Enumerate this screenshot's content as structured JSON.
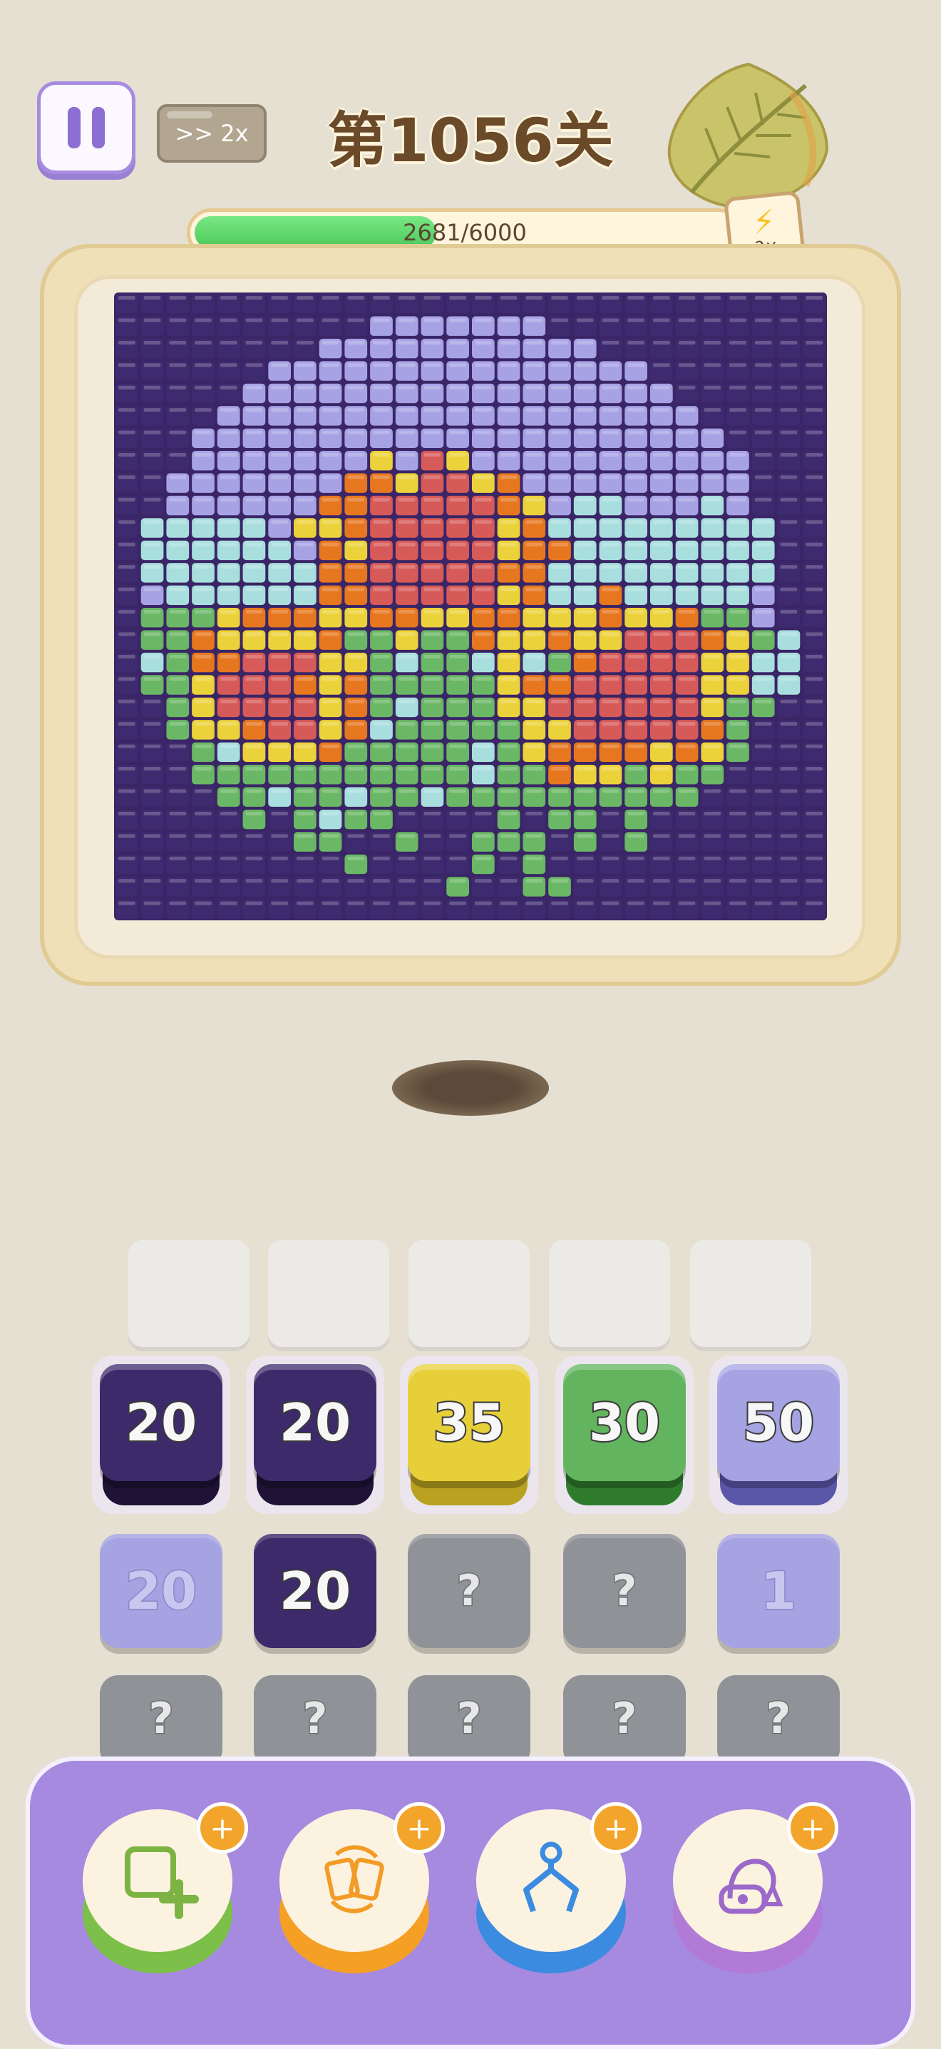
{
  "header": {
    "level_title": "第1056关",
    "speed_label": ">> 2x",
    "pause_icon": "pause-icon"
  },
  "progress": {
    "text": "2681/6000",
    "current": 2681,
    "max": 6000,
    "fill_color": "#4cc85a",
    "boost_label": "2×",
    "boost_icon": "lightning-icon"
  },
  "board": {
    "palette": {
      "P": "#3e2a6e",
      "L": "#a7a2e4",
      "C": "#a9dede",
      "O": "#e6771f",
      "Y": "#ecd23a",
      "R": "#d65a58",
      "G": "#6ab765"
    },
    "rows": [
      "PPPPPPPPPPPPPPPPPPPPPPPPPPPP",
      "PPPPPPPPPPLLLLLLLPPPPPPPPPPP",
      "PPPPPPPPLLLLLLLLLLLPPPPPPPPP",
      "PPPPPPLLLLLLLLLLLLLLLPPPPPPP",
      "PPPPPLLLLLLLLLLLLLLLLLPPPPPP",
      "PPPPLLLLLLLLLLLLLLLLLLLPPPPP",
      "PPPLLLLLLLLLLLLLLLLLLLLLPPPP",
      "PPPLLLLLLLYLRYLLLLLLLLLLLPPP",
      "PPLLLLLLLOOYRRYOLLLLLLLLLPPP",
      "PPLLLLLLOORRRRROYLCCLLLCLPPP",
      "PCCCCCLYYORRRRRYOCCCCCCCCCPP",
      "PCCCCCCLOYRRRRRYOOCCCCCCCCPP",
      "PCCCCCCCOORRRRROOCCCCCCCCCPP",
      "PLCCCCCCOORRRRRYOCCOCCCCCLPP",
      "PGGGYOOOYYOOYYOOYYYOYYOGGLPP",
      "PGGOYYYYOGGYGGOYYOYYRRROYGCP",
      "PCGOORRRYYGCGGCYCGORRRRYYCCP",
      "PGGYRRROYOGGGGGYOORRRRRYYCCP",
      "PPGYRRRRYOGCGGGYYRRRRRRYGGPP",
      "PPGYYORRYOCGGGGGYYRRRRROGPPP",
      "PPPGCYYYOGGGGGCGYOOOOYOYGPPP",
      "PPPGGGGGGGGGGGCGGOYYGYGGPPPP",
      "PPPPGGCGGCGGCGGGGGGGGGGPPPPP",
      "PPPPPGPGCGGPPPPGPGGPGPPPPPPP",
      "PPPPPPPGGPPGPPGGGPGPGPPPPPPP",
      "PPPPPPPPPGPPPPGPGPPPPPPPPPPP",
      "PPPPPPPPPPPPPGPPGGPPPPPPPPPP",
      "PPPPPPPPPPPPPPPPPPPPPPPPPPPP"
    ]
  },
  "queue": {
    "empty_slots": 5
  },
  "tiles_row1": [
    {
      "value": "20",
      "color": "#3d2a6a",
      "under": "#1e1336"
    },
    {
      "value": "20",
      "color": "#3d2a6a",
      "under": "#1e1336"
    },
    {
      "value": "35",
      "color": "#e7cf3a",
      "under": "#b8a21f"
    },
    {
      "value": "30",
      "color": "#62b45e",
      "under": "#2f7b2c"
    },
    {
      "value": "50",
      "color": "#a6a3e2",
      "under": "#5a57a8"
    }
  ],
  "tiles_row2": [
    {
      "value": "20",
      "color": "#a6a3e2"
    },
    {
      "value": "20",
      "color": "#3d2a6a"
    },
    {
      "value": "?",
      "color": "#8f9296"
    },
    {
      "value": "?",
      "color": "#8f9296"
    },
    {
      "value": "1",
      "color": "#a6a3e2"
    }
  ],
  "tiles_row3": [
    {
      "value": "?",
      "color": "#8f9296"
    },
    {
      "value": "?",
      "color": "#8f9296"
    },
    {
      "value": "?",
      "color": "#8f9296"
    },
    {
      "value": "?",
      "color": "#8f9296"
    },
    {
      "value": "?",
      "color": "#8f9296"
    }
  ],
  "tools": [
    {
      "name": "add-slot-icon",
      "base": "#7cc04a",
      "plus": "+"
    },
    {
      "name": "shuffle-icon",
      "base": "#f5a025",
      "plus": "+"
    },
    {
      "name": "claw-icon",
      "base": "#3b8be0",
      "plus": "+"
    },
    {
      "name": "vacuum-icon",
      "base": "#b07ad6",
      "plus": "+"
    }
  ]
}
